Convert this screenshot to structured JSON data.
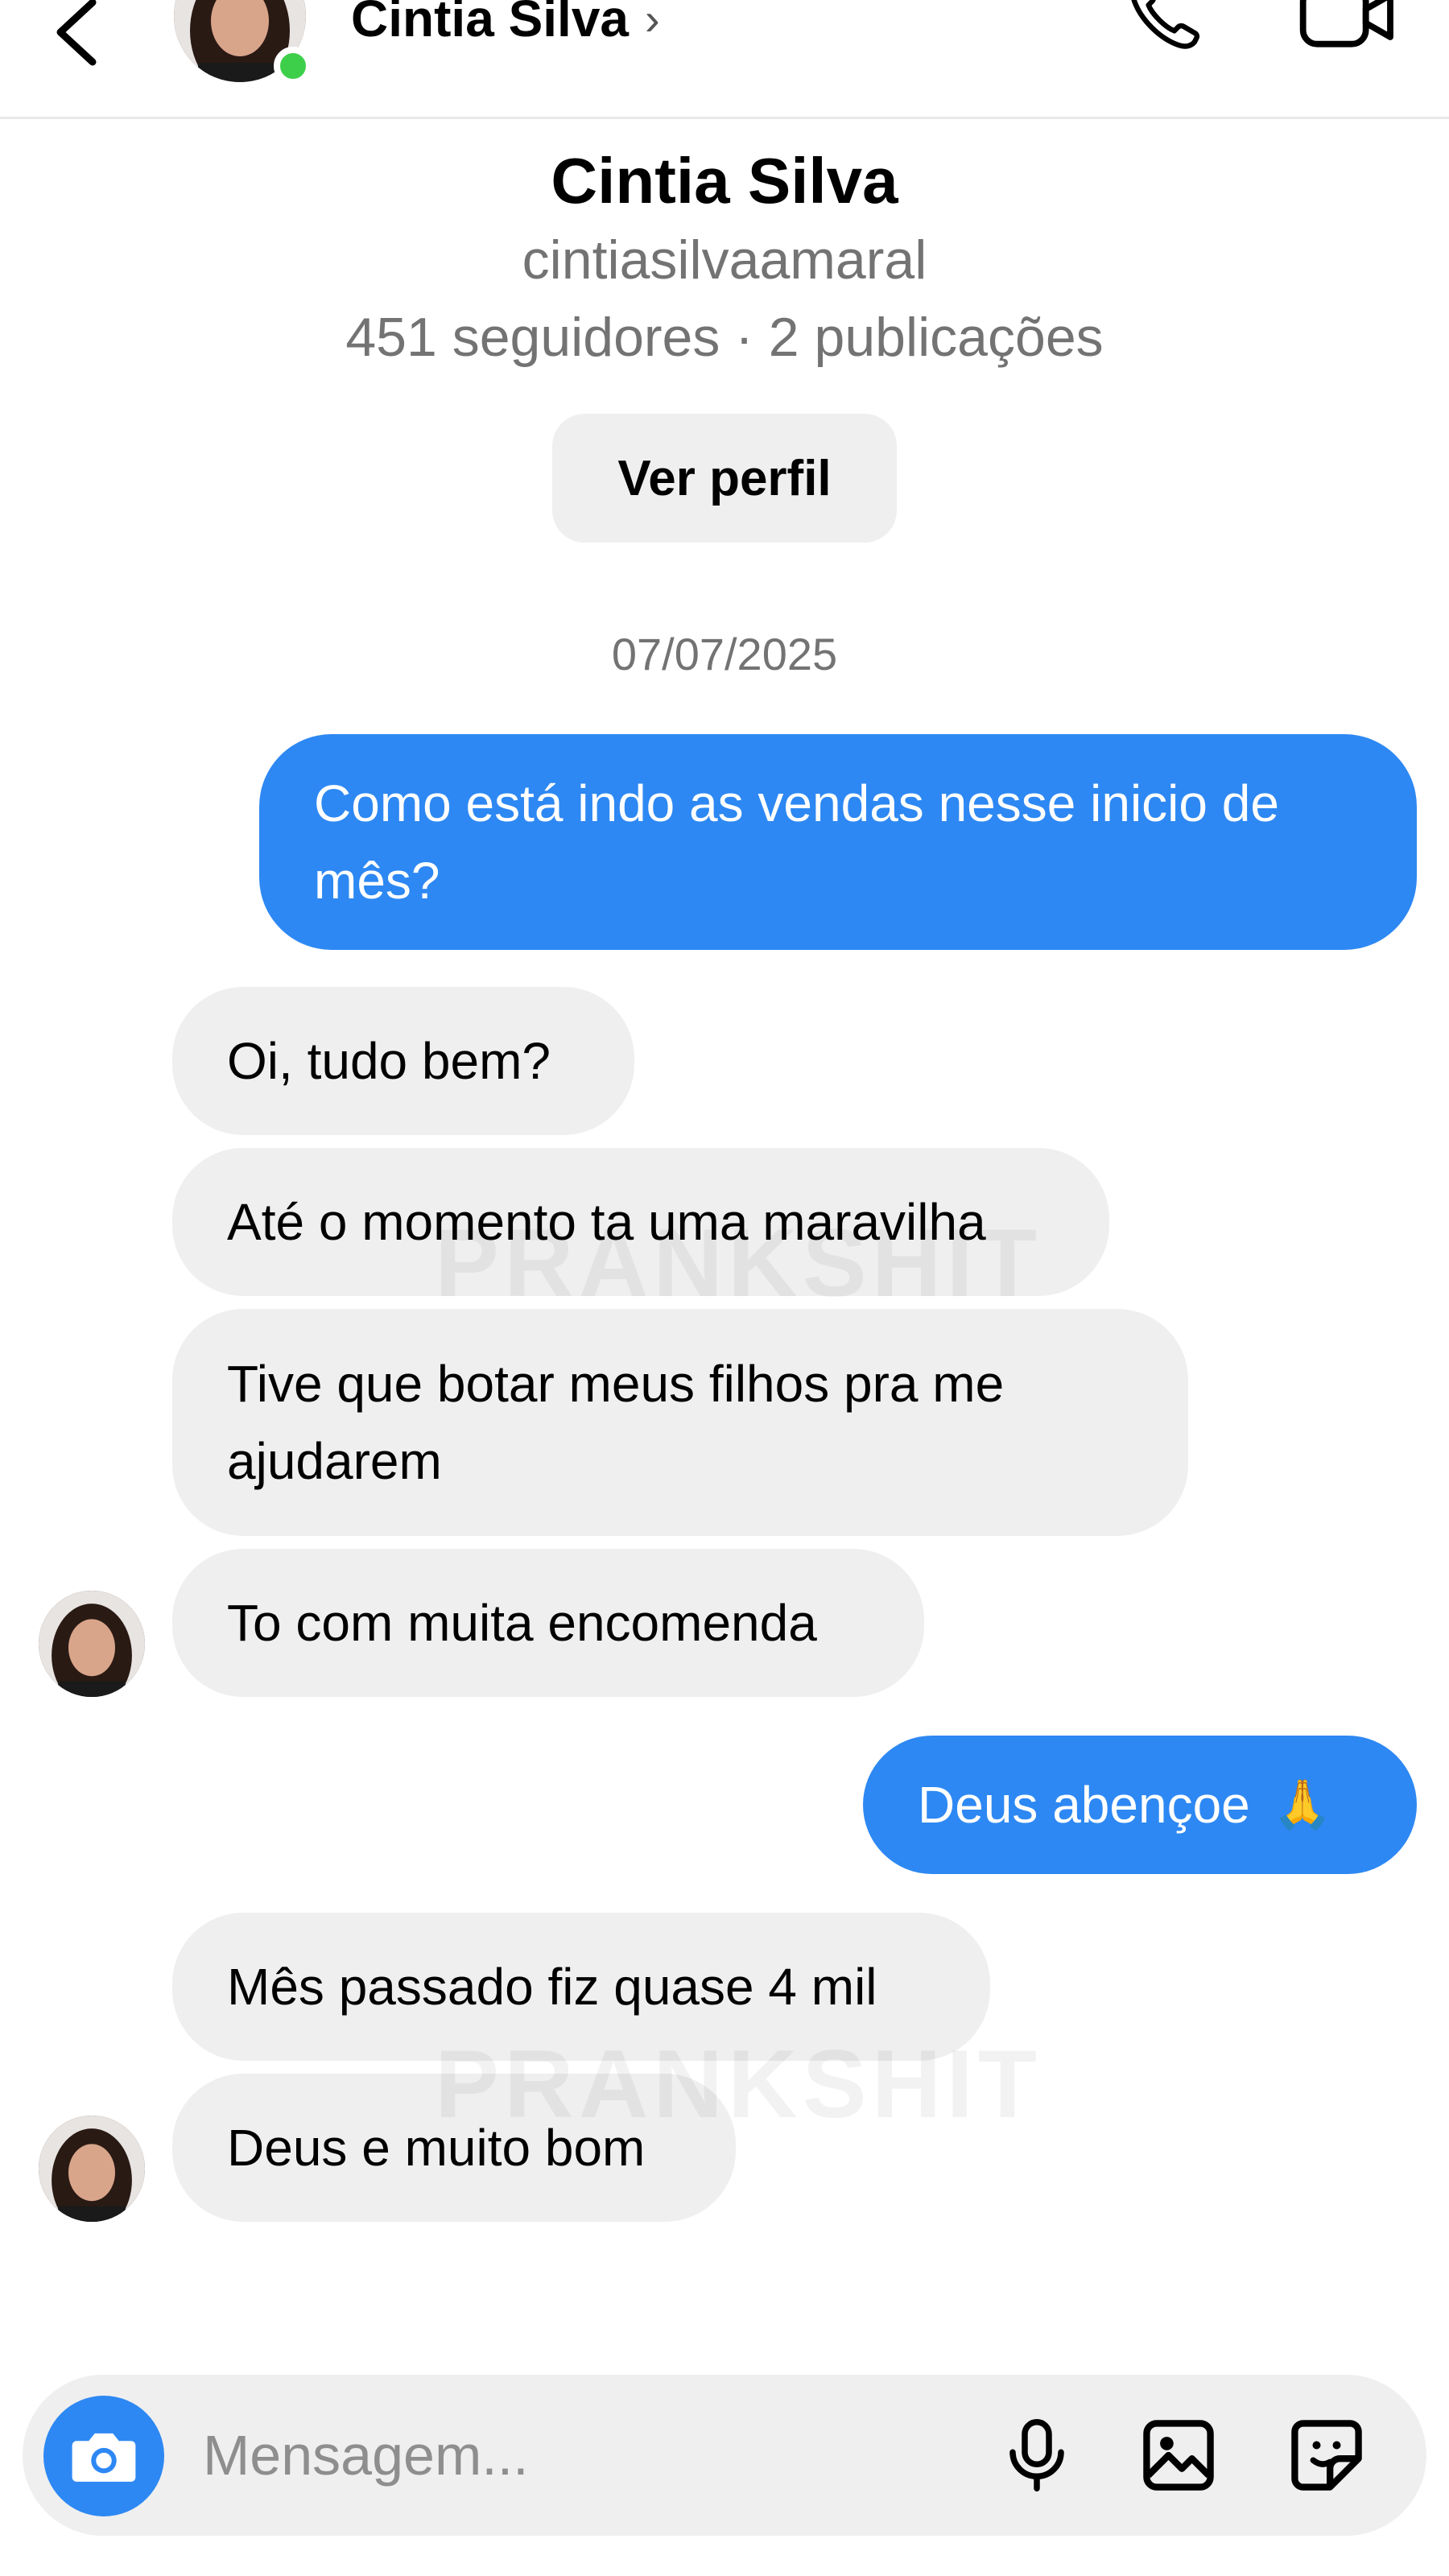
{
  "header": {
    "contact_name": "Cintia Silva",
    "chevron": "›",
    "online": true
  },
  "profile": {
    "name": "Cintia Silva",
    "username": "cintiasilvaamaral",
    "stats": "451 seguidores · 2 publicações",
    "view_profile_label": "Ver perfil"
  },
  "date_separator": "07/07/2025",
  "messages": [
    {
      "direction": "outgoing",
      "text": "Como está indo as vendas nesse inicio de mês?"
    },
    {
      "direction": "incoming",
      "text": "Oi, tudo bem?"
    },
    {
      "direction": "incoming",
      "text": "Até o momento ta uma maravilha"
    },
    {
      "direction": "incoming",
      "text": "Tive que botar meus filhos pra me ajudarem"
    },
    {
      "direction": "incoming",
      "text": "To com muita encomenda"
    },
    {
      "direction": "outgoing",
      "text": "Deus abençoe",
      "emoji": "🙏"
    },
    {
      "direction": "incoming",
      "text": "Mês passado fiz quase 4 mil"
    },
    {
      "direction": "incoming",
      "text": "Deus e muito bom"
    }
  ],
  "watermark": "PRANKSHIT",
  "composer": {
    "placeholder": "Mensagem..."
  },
  "icons": {
    "back": "back-arrow-icon",
    "call": "phone-icon",
    "video": "video-camera-icon",
    "camera": "camera-icon",
    "mic": "microphone-icon",
    "gallery": "image-icon",
    "sticker": "sticker-icon"
  },
  "colors": {
    "outgoing_bubble": "#2d88f3",
    "incoming_bubble": "#efefef",
    "online": "#3ecf4a",
    "secondary_text": "#737373"
  }
}
